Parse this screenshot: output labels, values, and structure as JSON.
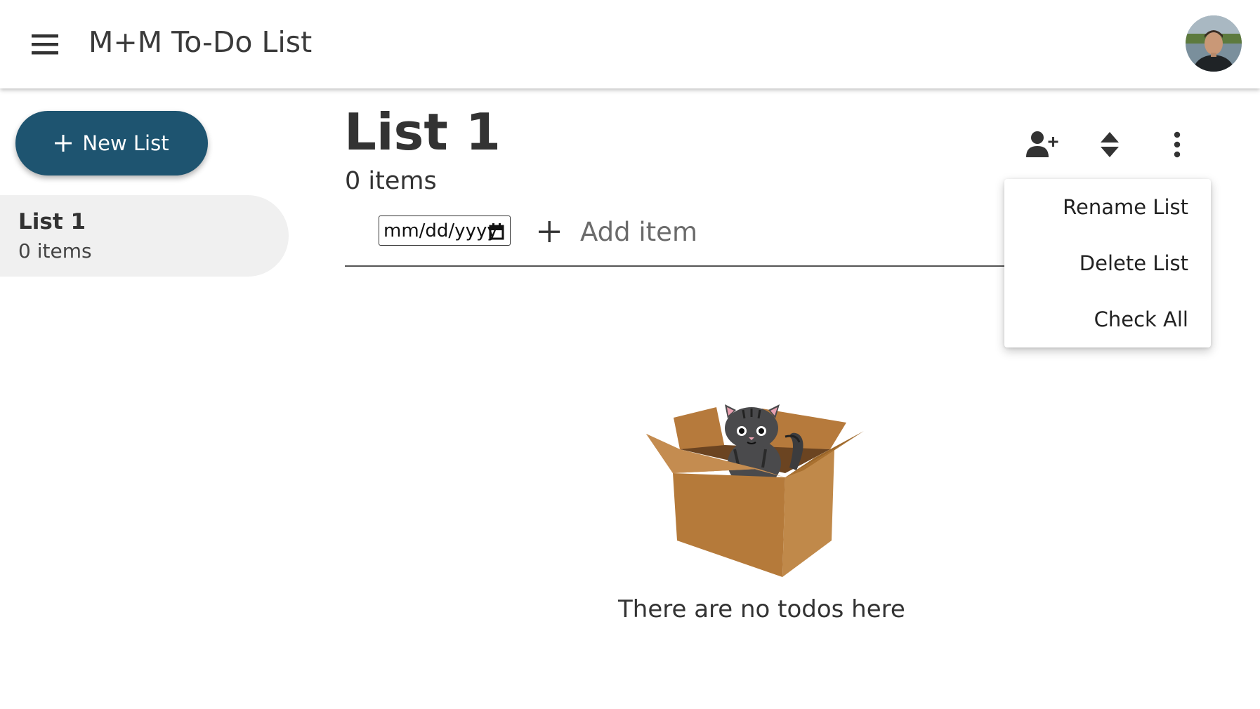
{
  "app": {
    "title": "M+M To-Do List"
  },
  "sidebar": {
    "new_list_label": "New List",
    "lists": [
      {
        "name": "List 1",
        "count": "0 items"
      }
    ]
  },
  "main": {
    "list_title": "List 1",
    "list_count": "0 items",
    "actions": [
      "person-add-icon",
      "sort-icon",
      "more-vert-icon"
    ],
    "date_input": {
      "value": "mm/dd/yyyy"
    },
    "add_item": {
      "placeholder": "Add item"
    },
    "empty_state": {
      "message": "There are no todos here"
    }
  },
  "menu": {
    "items": [
      "Rename List",
      "Delete List",
      "Check All"
    ]
  },
  "colors": {
    "primary": "#1e5470",
    "sidebar_item_bg": "#f0f0f0",
    "box": "#c08744"
  }
}
